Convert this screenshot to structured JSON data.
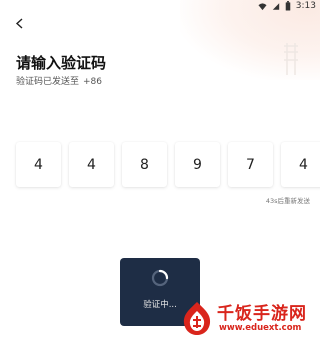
{
  "status_bar": {
    "time": "3:13",
    "icons": [
      "wifi-icon",
      "signal-icon",
      "battery-icon"
    ]
  },
  "header": {
    "back_icon": "chevron-left-icon",
    "title": "请输入验证码",
    "subtitle": "验证码已发送至",
    "phone_prefix": "+86"
  },
  "code": {
    "digits": [
      "4",
      "4",
      "8",
      "9",
      "7",
      "4"
    ]
  },
  "resend": {
    "text": "43s后重新发送"
  },
  "loading": {
    "text": "验证中..."
  },
  "watermark": {
    "logo_char": "饭",
    "title": "千饭手游网",
    "url": "www.eduext.com"
  },
  "colors": {
    "toast_bg": "#1e2d45",
    "watermark_red": "#d9251c",
    "box_bg": "#ffffff"
  }
}
